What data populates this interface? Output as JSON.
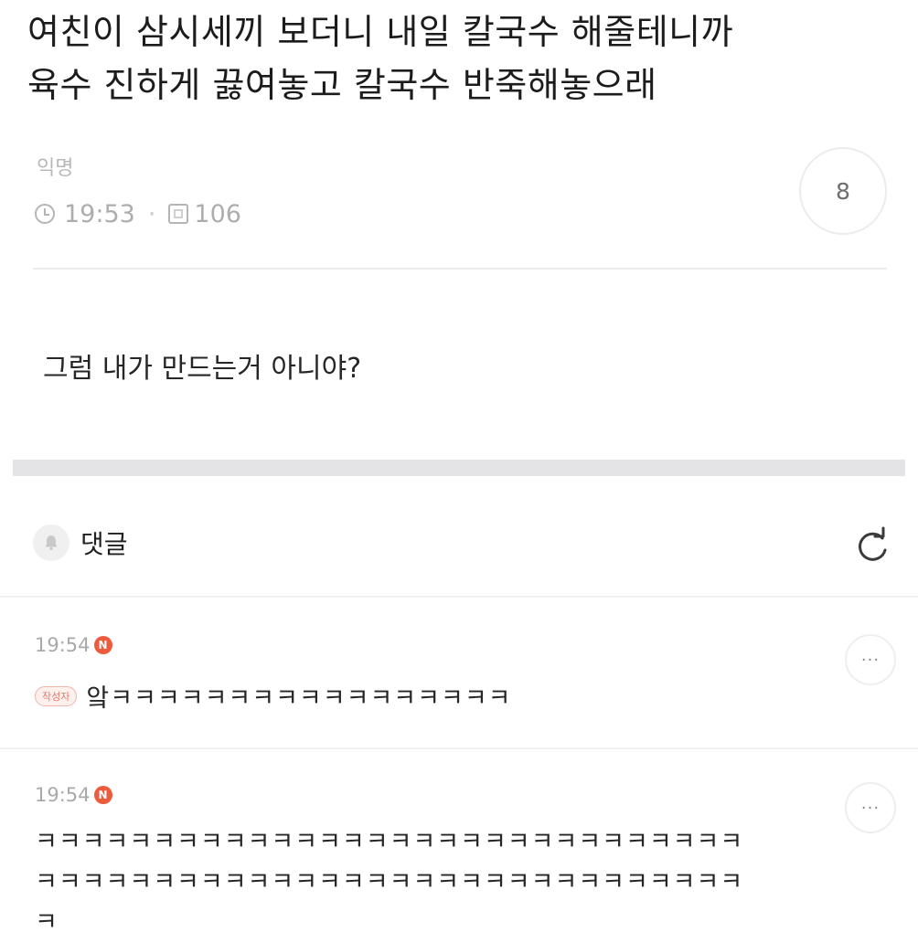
{
  "post": {
    "title_line1": "여친이 삼시세끼 보더니 내일 칼국수 해줄테니까",
    "title_line2": "육수 진하게 끓여놓고 칼국수 반죽해놓으래",
    "author": "익명",
    "time": "19:53",
    "meta_separator": "·",
    "views": "106",
    "comment_count": "8",
    "body": "그럼 내가 만드는거 아니야?"
  },
  "comments_section": {
    "label": "댓글",
    "bell_icon": "bell-icon",
    "refresh_icon": "refresh-icon"
  },
  "comments": [
    {
      "time": "19:54",
      "new_badge": "N",
      "author_badge": "작성자",
      "text": "앜ㅋㅋㅋㅋㅋㅋㅋㅋㅋㅋㅋㅋㅋㅋㅋㅋㅋ",
      "more": "···"
    },
    {
      "time": "19:54",
      "new_badge": "N",
      "text_line1": "ㅋㅋㅋㅋㅋㅋㅋㅋㅋㅋㅋㅋㅋㅋㅋㅋㅋㅋㅋㅋㅋㅋㅋㅋㅋㅋㅋㅋㅋㅋ",
      "text_line2": "ㅋㅋㅋㅋㅋㅋㅋㅋㅋㅋㅋㅋㅋㅋㅋㅋㅋㅋㅋㅋㅋㅋㅋㅋㅋㅋㅋㅋㅋㅋ",
      "text_line3": "ㅋ",
      "more": "···"
    }
  ],
  "colors": {
    "new_badge": "#ee5a3c",
    "meta_text": "#adadad",
    "section_divider": "#e4e4e7"
  }
}
